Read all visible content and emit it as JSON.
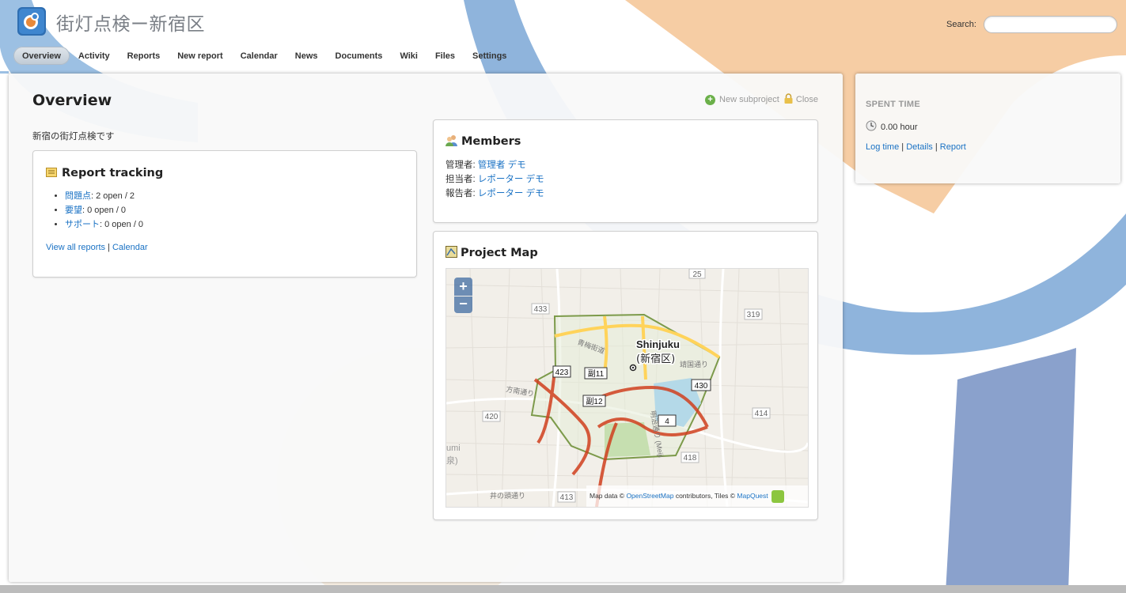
{
  "header": {
    "project_title": "街灯点検ー新宿区",
    "search_label": "Search:",
    "search_value": ""
  },
  "menu": [
    {
      "label": "Overview",
      "selected": true
    },
    {
      "label": "Activity"
    },
    {
      "label": "Reports"
    },
    {
      "label": "New report"
    },
    {
      "label": "Calendar"
    },
    {
      "label": "News"
    },
    {
      "label": "Documents"
    },
    {
      "label": "Wiki"
    },
    {
      "label": "Files"
    },
    {
      "label": "Settings"
    }
  ],
  "content": {
    "title": "Overview",
    "contextual": {
      "new_subproject": "New subproject",
      "close": "Close"
    },
    "description": "新宿の街灯点検です",
    "report_tracking": {
      "title": "Report tracking",
      "items": [
        {
          "label": "問題点",
          "counts": ": 2 open / 2"
        },
        {
          "label": "要望",
          "counts": ": 0 open / 0"
        },
        {
          "label": "サポート",
          "counts": ": 0 open / 0"
        }
      ],
      "view_all": "View all reports",
      "separator": " | ",
      "calendar": "Calendar"
    },
    "members": {
      "title": "Members",
      "rows": [
        {
          "role": "管理者: ",
          "name": "管理者 デモ"
        },
        {
          "role": "担当者: ",
          "name": "レポーター デモ"
        },
        {
          "role": "報告者: ",
          "name": "レポーター デモ"
        }
      ]
    },
    "project_map": {
      "title": "Project Map",
      "zoom_in": "+",
      "zoom_out": "−",
      "place_label": "Shinjuku",
      "place_label_jp": "(新宿区)",
      "road_labels": [
        "25",
        "433",
        "319",
        "423",
        "副11",
        "430",
        "副12",
        "4",
        "420",
        "414",
        "418",
        "413",
        "青梅街道",
        "靖国通り",
        "明治通り (Meiji",
        "方南通り",
        "井の頭通り",
        "umi",
        "泉)"
      ],
      "attribution": {
        "prefix": "Map data © ",
        "osm": "OpenStreetMap",
        "middle": " contributors, Tiles © ",
        "mapquest": "MapQuest"
      }
    }
  },
  "sidebar": {
    "heading": "SPENT TIME",
    "value": "0.00 hour",
    "links": {
      "log_time": "Log time",
      "details": "Details",
      "report": "Report",
      "sep": " | "
    }
  }
}
